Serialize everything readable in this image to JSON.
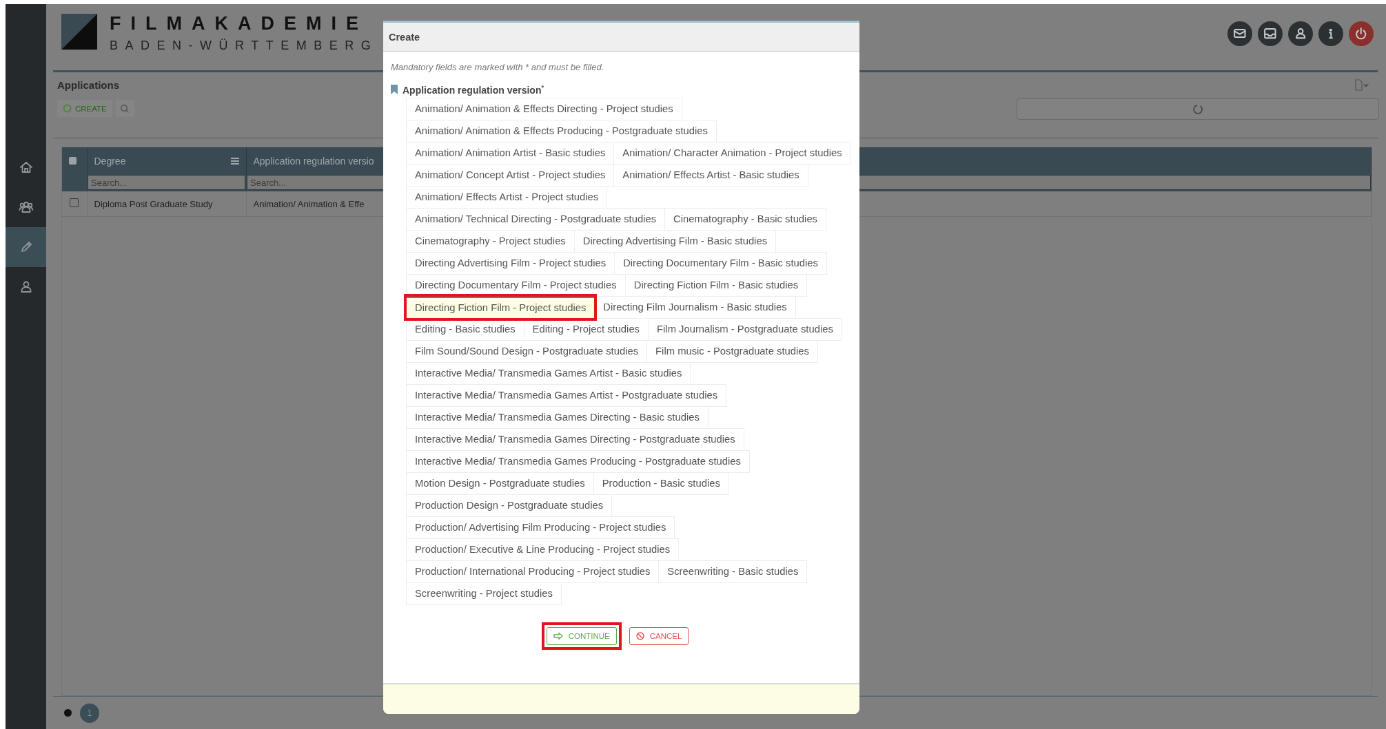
{
  "header": {
    "logo_title": "FILMAKADEMIE",
    "logo_subtitle": "BADEN-WÜRTTEMBERG"
  },
  "sidebar": {
    "items": [
      {
        "selected": false
      },
      {
        "selected": false
      },
      {
        "selected": true
      },
      {
        "selected": false
      }
    ]
  },
  "panel": {
    "title": "Applications",
    "create_button": "CREATE",
    "table": {
      "all_checked": false,
      "columns": [
        {
          "label": "Degree",
          "search_placeholder": "Search..."
        },
        {
          "label": "Application regulation versio",
          "search_placeholder": "Search..."
        }
      ],
      "rows": [
        {
          "checked": false,
          "cells": [
            "Diploma Post Graduate Study",
            "Animation/ Animation & Effe"
          ]
        }
      ]
    },
    "pagination": {
      "pages": [
        {
          "label": "1",
          "selected": true
        }
      ]
    }
  },
  "dialog": {
    "title": "Create",
    "note": "Mandatory fields are marked with * and must be filled.",
    "field": {
      "label": "Application regulation version",
      "required_mark": "*",
      "options": [
        {
          "label": "Animation/ Animation & Effects Directing - Project studies",
          "selected": false,
          "highlighted": false
        },
        {
          "label": "Animation/ Animation & Effects Producing - Postgraduate studies",
          "selected": false,
          "highlighted": false
        },
        {
          "label": "Animation/ Animation Artist - Basic studies",
          "selected": false,
          "highlighted": false
        },
        {
          "label": "Animation/ Character Animation - Project studies",
          "selected": false,
          "highlighted": false
        },
        {
          "label": "Animation/ Concept Artist - Project studies",
          "selected": false,
          "highlighted": false
        },
        {
          "label": "Animation/ Effects Artist - Basic studies",
          "selected": false,
          "highlighted": false
        },
        {
          "label": "Animation/ Effects Artist - Project studies",
          "selected": false,
          "highlighted": false
        },
        {
          "label": "Animation/ Technical Directing - Postgraduate studies",
          "selected": false,
          "highlighted": false
        },
        {
          "label": "Cinematography - Basic studies",
          "selected": false,
          "highlighted": false
        },
        {
          "label": "Cinematography - Project studies",
          "selected": false,
          "highlighted": false
        },
        {
          "label": "Directing Advertising Film - Basic studies",
          "selected": false,
          "highlighted": false
        },
        {
          "label": "Directing Advertising Film - Project studies",
          "selected": false,
          "highlighted": false
        },
        {
          "label": "Directing Documentary Film - Basic studies",
          "selected": false,
          "highlighted": false
        },
        {
          "label": "Directing Documentary Film - Project studies",
          "selected": false,
          "highlighted": false
        },
        {
          "label": "Directing Fiction Film - Basic studies",
          "selected": false,
          "highlighted": false
        },
        {
          "label": "Directing Fiction Film - Project studies",
          "selected": true,
          "highlighted": true
        },
        {
          "label": "Directing Film Journalism - Basic studies",
          "selected": false,
          "highlighted": false
        },
        {
          "label": "Editing - Basic studies",
          "selected": false,
          "highlighted": false
        },
        {
          "label": "Editing - Project studies",
          "selected": false,
          "highlighted": false
        },
        {
          "label": "Film Journalism - Postgraduate studies",
          "selected": false,
          "highlighted": false
        },
        {
          "label": "Film Sound/Sound Design - Postgraduate studies",
          "selected": false,
          "highlighted": false
        },
        {
          "label": "Film music - Postgraduate studies",
          "selected": false,
          "highlighted": false
        },
        {
          "label": "Interactive Media/ Transmedia Games Artist - Basic studies",
          "selected": false,
          "highlighted": false
        },
        {
          "label": "Interactive Media/ Transmedia Games Artist - Postgraduate studies",
          "selected": false,
          "highlighted": false
        },
        {
          "label": "Interactive Media/ Transmedia Games Directing - Basic studies",
          "selected": false,
          "highlighted": false
        },
        {
          "label": "Interactive Media/ Transmedia Games Directing - Postgraduate studies",
          "selected": false,
          "highlighted": false
        },
        {
          "label": "Interactive Media/ Transmedia Games Producing - Postgraduate studies",
          "selected": false,
          "highlighted": false
        },
        {
          "label": "Motion Design - Postgraduate studies",
          "selected": false,
          "highlighted": false
        },
        {
          "label": "Production - Basic studies",
          "selected": false,
          "highlighted": false
        },
        {
          "label": "Production Design - Postgraduate studies",
          "selected": false,
          "highlighted": false
        },
        {
          "label": "Production/ Advertising Film Producing - Project studies",
          "selected": false,
          "highlighted": false
        },
        {
          "label": "Production/ Executive & Line Producing - Project studies",
          "selected": false,
          "highlighted": false
        },
        {
          "label": "Production/ International Producing - Project studies",
          "selected": false,
          "highlighted": false
        },
        {
          "label": "Screenwriting - Basic studies",
          "selected": false,
          "highlighted": false
        },
        {
          "label": "Screenwriting - Project studies",
          "selected": false,
          "highlighted": false
        }
      ]
    },
    "buttons": [
      {
        "kind": "continue",
        "label": "CONTINUE",
        "highlighted": true
      },
      {
        "kind": "cancel",
        "label": "CANCEL",
        "highlighted": false
      }
    ]
  }
}
